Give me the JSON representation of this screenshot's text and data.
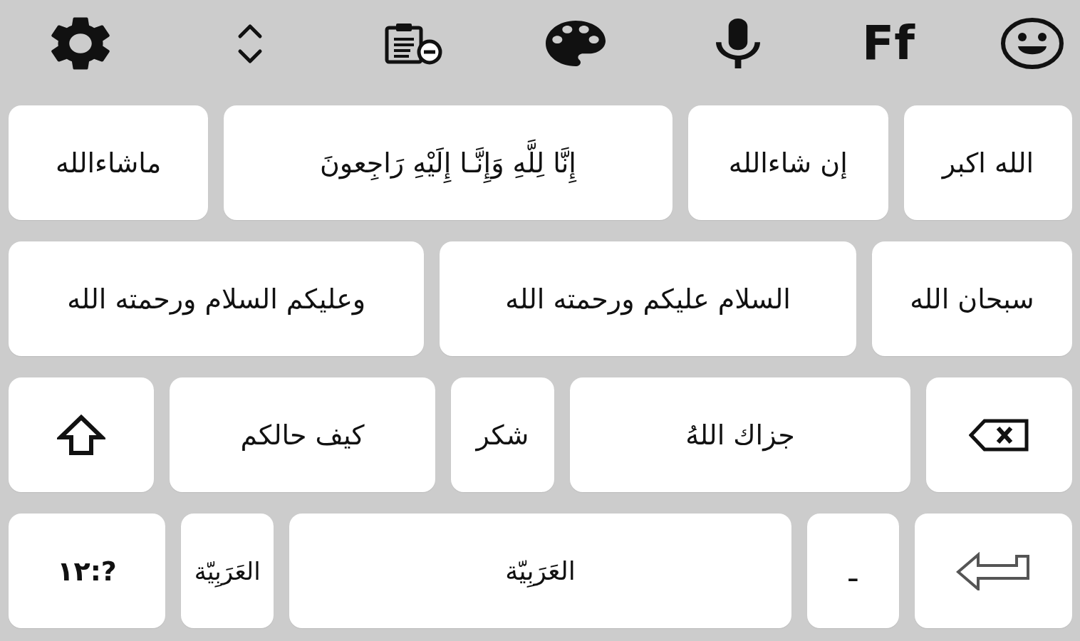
{
  "toolbar": [
    {
      "kind": "settings"
    },
    {
      "kind": "resize"
    },
    {
      "kind": "clipboard"
    },
    {
      "kind": "theme"
    },
    {
      "kind": "voice"
    },
    {
      "kind": "font",
      "label": "Ff"
    },
    {
      "kind": "emoji"
    }
  ],
  "rows": [
    {
      "keys": [
        {
          "kind": "phrase",
          "label": "الله اكبر"
        },
        {
          "kind": "phrase",
          "label": "إن شاءالله"
        },
        {
          "kind": "phrase",
          "label": "إِنَّا لِلَّهِ وَإِنَّـا إِلَيْهِ رَاجِعونَ"
        },
        {
          "kind": "phrase",
          "label": "ماشاءالله"
        }
      ]
    },
    {
      "keys": [
        {
          "kind": "phrase",
          "label": "سبحان الله"
        },
        {
          "kind": "phrase",
          "label": "السلام عليكم ورحمته الله"
        },
        {
          "kind": "phrase",
          "label": "وعليكم السلام ورحمته الله"
        }
      ]
    },
    {
      "keys": [
        {
          "kind": "backspace"
        },
        {
          "kind": "phrase",
          "label": "جزاك اللهُ"
        },
        {
          "kind": "phrase",
          "label": "شكر"
        },
        {
          "kind": "phrase",
          "label": "كيف حالكم"
        },
        {
          "kind": "shift"
        }
      ]
    },
    {
      "keys": [
        {
          "kind": "enter"
        },
        {
          "kind": "char",
          "label": "ـ"
        },
        {
          "kind": "space",
          "label": "العَرَبِيّة"
        },
        {
          "kind": "language",
          "label": "العَرَبِيّة"
        },
        {
          "kind": "symbols",
          "label": "١٢:?"
        }
      ]
    }
  ]
}
